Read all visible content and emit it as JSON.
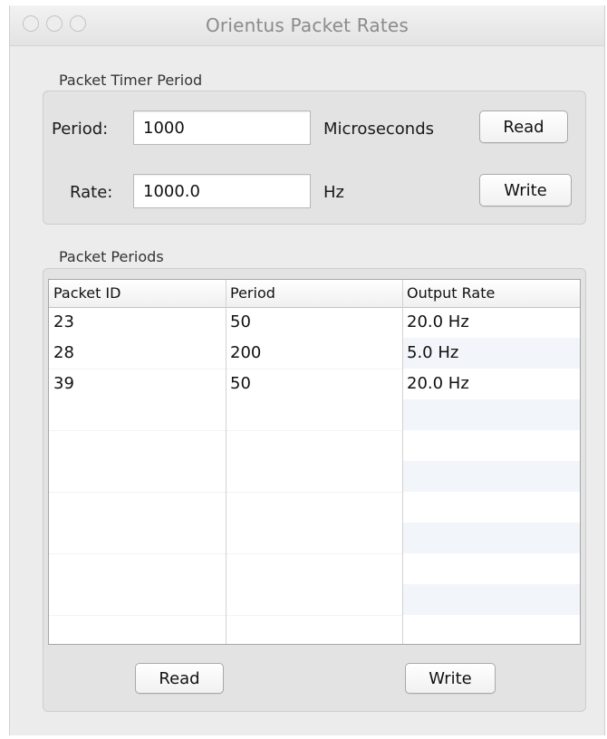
{
  "window": {
    "title": "Orientus Packet Rates"
  },
  "timer": {
    "group_label": "Packet Timer Period",
    "period_label": "Period:",
    "period_value": "1000",
    "period_unit": "Microseconds",
    "rate_label": "Rate:",
    "rate_value": "1000.0",
    "rate_unit": "Hz",
    "read_label": "Read",
    "write_label": "Write"
  },
  "packets": {
    "group_label": "Packet Periods",
    "columns": [
      "Packet ID",
      "Period",
      "Output Rate"
    ],
    "rows": [
      [
        "23",
        "50",
        "20.0 Hz"
      ],
      [
        "28",
        "200",
        "5.0 Hz"
      ],
      [
        "39",
        "50",
        "20.0 Hz"
      ]
    ],
    "read_label": "Read",
    "write_label": "Write"
  }
}
